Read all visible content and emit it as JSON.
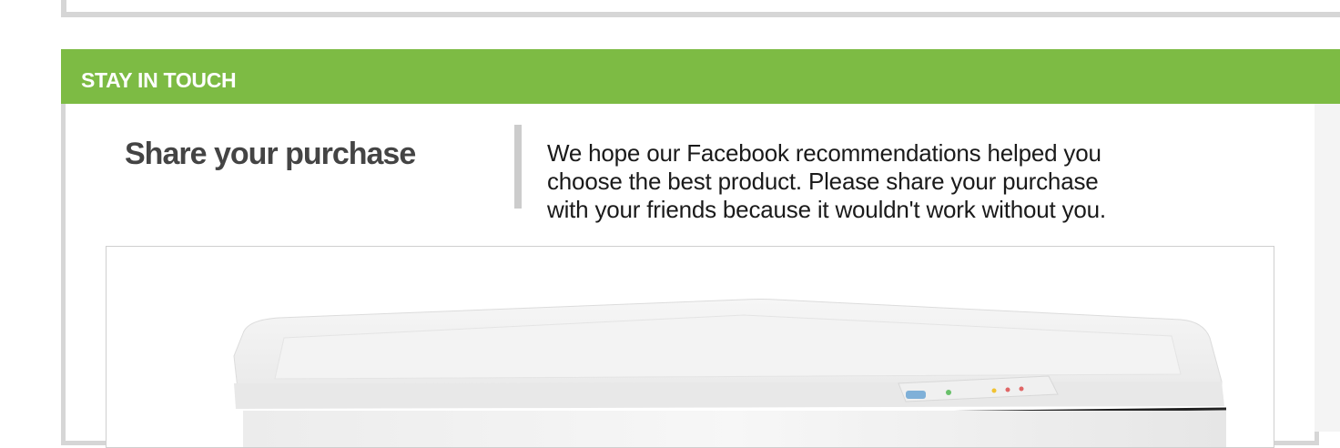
{
  "header": {
    "title": "STAY IN TOUCH"
  },
  "share": {
    "title": "Share your purchase",
    "lines": [
      "We hope our Facebook recommendations helped you",
      "choose the best product. Please share your purchase",
      "with your friends because it wouldn't work without you."
    ]
  },
  "product_image": {
    "subject": "white chest freezer"
  },
  "colors": {
    "accent_green": "#7dbb44",
    "border_gray": "#d6d6d6",
    "title_text": "#444444"
  }
}
